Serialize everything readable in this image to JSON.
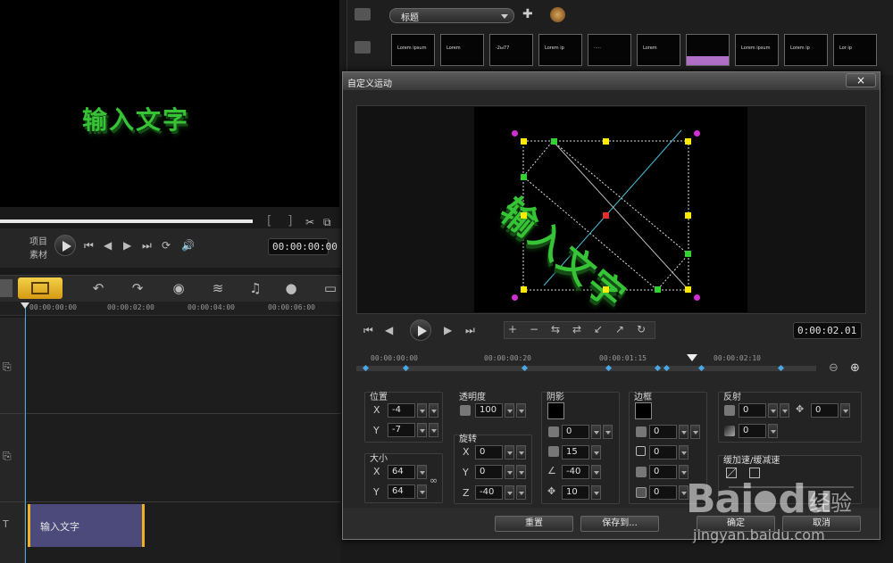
{
  "preview": {
    "text": "输入文字",
    "mode_project": "项目",
    "mode_clip": "素材",
    "timecode": "00:00:00:00"
  },
  "timeline": {
    "ruler": [
      "00:00:00:00",
      "00:00:02:00",
      "00:00:04:00",
      "00:00:06:00"
    ],
    "clip_label": "输入文字"
  },
  "library": {
    "category": "标题",
    "thumbnails": [
      "Lorem ipsum",
      "Lorem",
      "-2ы77",
      "Lorem ip",
      "·····",
      "Lorem",
      "",
      "Lorem ipsum",
      "Lorem ip",
      "Lor ip"
    ]
  },
  "dialog": {
    "title": "自定义运动",
    "close": "×",
    "canvas_text": "输入文字",
    "timecode": "0:00:02.01",
    "ruler": [
      "00:00:00:00",
      "00:00:00:20",
      "00:00:01:15",
      "00:00:02:10"
    ],
    "playhead_position": 0.74,
    "keyframes": [
      0.0,
      0.09,
      0.36,
      0.55,
      0.66,
      0.68,
      0.76,
      0.94
    ],
    "position": {
      "label": "位置",
      "x": "-4",
      "y": "-7"
    },
    "size": {
      "label": "大小",
      "x": "64",
      "y": "64"
    },
    "opacity": {
      "label": "透明度",
      "value": "100"
    },
    "rotation": {
      "label": "旋转",
      "x": "0",
      "y": "0",
      "z": "-40"
    },
    "shadow": {
      "label": "阴影",
      "color": "#000000",
      "opacity": "0",
      "blur": "15",
      "angle": "-40",
      "distance": "10"
    },
    "border": {
      "label": "边框",
      "color": "#000000",
      "opacity": "0",
      "thickness": "0",
      "blur": "0",
      "value3": "0"
    },
    "reflection": {
      "label": "反射",
      "opacity": "0",
      "distance": "0",
      "gradient": "0"
    },
    "easing": {
      "label": "缓加速/缓减速"
    },
    "buttons": {
      "reset": "重置",
      "save_to": "保存到...",
      "ok": "确定",
      "cancel": "取消"
    }
  },
  "watermark": {
    "brand": "Bai",
    "brand_du": "du",
    "zh": "经验",
    "url": "jingyan.baidu.com"
  }
}
